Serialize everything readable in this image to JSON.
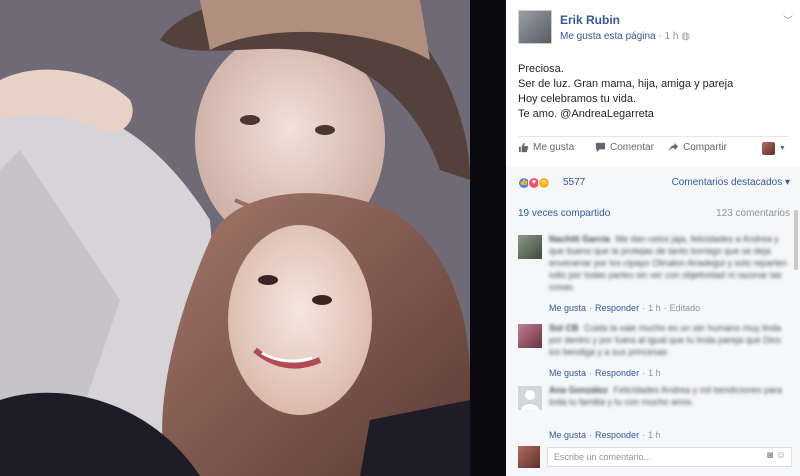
{
  "post": {
    "author": "Erik Rubin",
    "like_page": "Me gusta esta página",
    "time": "1 h",
    "lines": [
      "Preciosa.",
      "Ser de luz. Gran mama, hija, amiga y pareja",
      "Hoy celebramos tu vida.",
      "Te amo. @AndreaLegarreta"
    ]
  },
  "actions": {
    "like": "Me gusta",
    "comment": "Comentar",
    "share": "Compartir"
  },
  "reactions": {
    "count": "5577",
    "top_comments": "Comentarios destacados ▾",
    "shares": "19 veces compartido",
    "comments": "123 comentarios"
  },
  "comments": [
    {
      "name": "Nachitt Garcia",
      "text": "Me dan celos jaja, felicidades a Andrea y que bueno que la protejas de tanto borrego que se deja envenenar por los cipayo Olinalon Ariadegui y solo reparten odio por todas partes sin ver con objetividad ni razonar las cosas.",
      "like": "Me gusta",
      "reply": "Responder",
      "time": "1 h",
      "edited": "Editado"
    },
    {
      "name": "Sol CB",
      "text": "Cuida la vale mucho es un ser humano muy linda por dentro y por fuera al igual que tu linda pareja que Dios los bendiga y a sus princesas",
      "like": "Me gusta",
      "reply": "Responder",
      "time": "1 h"
    },
    {
      "name": "Ana González",
      "text": "Felicidades Andrea y mil bendiciones para toda tu familia y tu con mucho amor.",
      "like": "Me gusta",
      "reply": "Responder",
      "time": "1 h"
    }
  ],
  "compose": {
    "placeholder": "Escribe un comentario..."
  },
  "colors": {
    "link": "#365899",
    "like_reaction": "#4080ff",
    "love_reaction": "#f25268",
    "haha_reaction": "#f7b125"
  }
}
